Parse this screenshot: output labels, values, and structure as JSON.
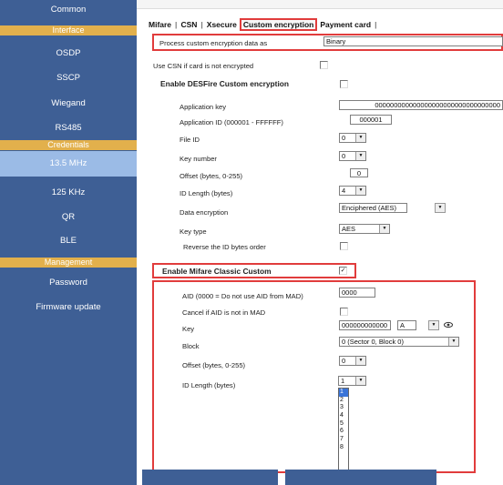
{
  "sidebar": {
    "common": "Common",
    "interface_header": "Interface",
    "osdp": "OSDP",
    "sscp": "SSCP",
    "wiegand": "Wiegand",
    "rs485": "RS485",
    "credentials_header": "Credentials",
    "mhz": "13.5 MHz",
    "khz": "125 KHz",
    "qr": "QR",
    "ble": "BLE",
    "management_header": "Management",
    "password": "Password",
    "firmware": "Firmware update"
  },
  "tabs": {
    "mifare": "Mifare",
    "csn": "CSN",
    "xsecure": "Xsecure",
    "custom": "Custom encryption",
    "payment": "Payment card"
  },
  "form": {
    "process_label": "Process custom encryption data as",
    "process_value": "Binary",
    "use_csn_label": "Use CSN if card is not encrypted",
    "desfire_header": "Enable DESFire Custom encryption",
    "app_key_label": "Application key",
    "app_key_value": "000000000000000000000000000000000",
    "app_id_label": "Application ID (000001 - FFFFFF)",
    "app_id_value": "000001",
    "file_id_label": "File ID",
    "file_id_value": "0",
    "key_number_label": "Key number",
    "key_number_value": "0",
    "offset_label": "Offset (bytes, 0-255)",
    "offset_value": "0",
    "id_length_label": "ID Length (bytes)",
    "id_length_value": "4",
    "data_enc_label": "Data encryption",
    "data_enc_value": "Enciphered (AES)",
    "key_type_label": "Key type",
    "key_type_value": "AES",
    "reverse_label": "Reverse the ID bytes order",
    "classic_header": "Enable Mifare Classic Custom",
    "aid_label": "AID (0000 = Do not use AID from MAD)",
    "aid_value": "0000",
    "cancel_label": "Cancel if AID is not in MAD",
    "key_label": "Key",
    "key_value": "000000000000",
    "key_ab_value": "A",
    "block_label": "Block",
    "block_value": "0 (Sector 0, Block 0)",
    "offset2_label": "Offset (bytes, 0-255)",
    "offset2_value": "0",
    "idlen2_label": "ID Length (bytes)",
    "idlen2_value": "1",
    "idlen_options": [
      "1",
      "2",
      "3",
      "4",
      "5",
      "6",
      "7",
      "8"
    ]
  },
  "colors": {
    "sidebar_bg": "#3e5f95",
    "section_header": "#e2b04c",
    "active_item": "#9bbbe6",
    "highlight_red": "#e13c3c"
  }
}
